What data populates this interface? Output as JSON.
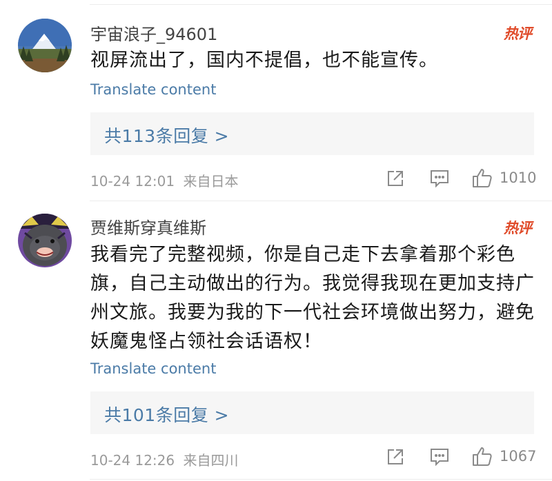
{
  "comments": [
    {
      "username": "宇宙浪子_94601",
      "hot_badge": "热评",
      "text": "视屏流出了，国内不提倡，也不能宣传。",
      "translate_label": "Translate content",
      "replies_label": "共113条回复 >",
      "timestamp": "10-24 12:01",
      "location": "来自日本",
      "likes": "1010"
    },
    {
      "username": "贾维斯穿真维斯",
      "hot_badge": "热评",
      "text": "我看完了完整视频，你是自己走下去拿着那个彩色旗，自己主动做出的行为。我觉得我现在更加支持广州文旅。我要为我的下一代社会环境做出努力，避免妖魔鬼怪占领社会话语权！",
      "translate_label": "Translate content",
      "replies_label": "共101条回复 >",
      "timestamp": "10-24 12:26",
      "location": "来自四川",
      "likes": "1067"
    }
  ],
  "icons": {
    "share": "share-icon",
    "comment": "comment-icon",
    "like": "thumbs-up-icon"
  },
  "colors": {
    "link": "#4b7ba7",
    "hot": "#e04b2a",
    "meta": "#9a9a9a",
    "reply_bg": "#f6f6f6"
  }
}
